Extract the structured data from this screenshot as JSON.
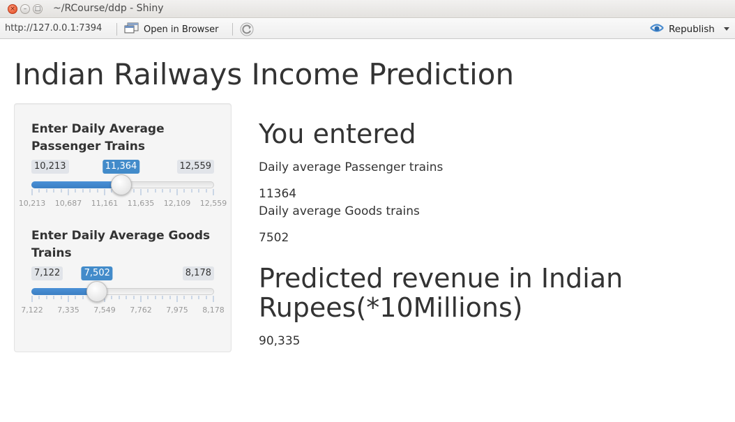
{
  "window": {
    "title": "~/RCourse/ddp - Shiny",
    "buttons": {
      "close": "×",
      "minimize": "–",
      "maximize": "□"
    }
  },
  "toolbar": {
    "url": "http://127.0.0.1:7394",
    "open_in_browser": "Open in Browser",
    "republish": "Republish",
    "icons": [
      "browser-window-icon",
      "refresh-icon",
      "republish-icon",
      "chevron-down-icon"
    ]
  },
  "page": {
    "title": "Indian Railways Income Prediction"
  },
  "sidebar": {
    "passenger": {
      "label": "Enter Daily Average Passenger Trains",
      "min_label": "10,213",
      "max_label": "12,559",
      "value_label": "11,364",
      "min": 10213,
      "max": 12559,
      "value": 11364,
      "grid": [
        "10,213",
        "10,687",
        "11,161",
        "11,635",
        "12,109",
        "12,559"
      ]
    },
    "goods": {
      "label": "Enter Daily Average Goods Trains",
      "min_label": "7,122",
      "max_label": "8,178",
      "value_label": "7,502",
      "min": 7122,
      "max": 8178,
      "value": 7502,
      "grid": [
        "7,122",
        "7,335",
        "7,549",
        "7,762",
        "7,975",
        "8,178"
      ]
    }
  },
  "main": {
    "entered_heading": "You entered",
    "passenger_label": "Daily average Passenger trains",
    "passenger_value": "11364",
    "goods_label": "Daily average Goods trains",
    "goods_value": "7502",
    "prediction_heading": "Predicted revenue in Indian Rupees(*10Millions)",
    "prediction_value": "90,335"
  },
  "colors": {
    "accent": "#428bca",
    "close_button": "#e0461c"
  }
}
